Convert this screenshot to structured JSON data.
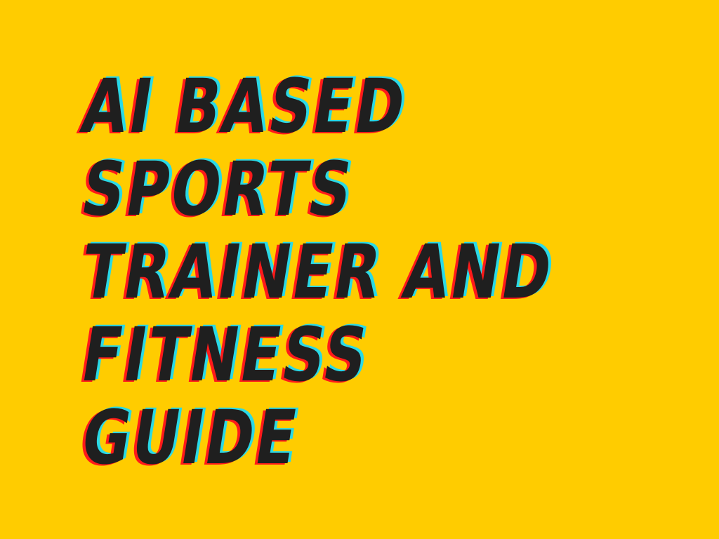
{
  "poster": {
    "title_lines": [
      "AI BASED",
      "SPORTS",
      "TRAINER AND",
      "FITNESS",
      "GUIDE"
    ]
  },
  "colors": {
    "background": "#FFCC00",
    "text": "#1F1F1F",
    "shadow_red": "#FF1A1A",
    "shadow_cyan": "#2AD9E6"
  }
}
